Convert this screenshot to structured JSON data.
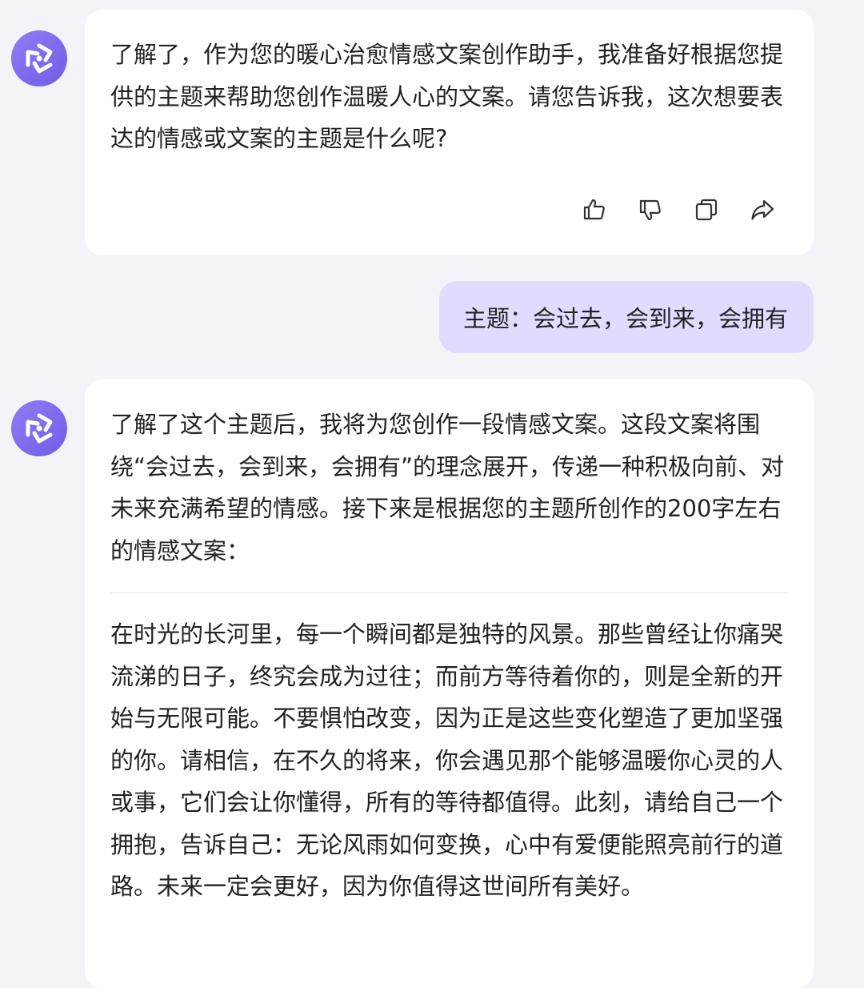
{
  "messages": [
    {
      "role": "assistant",
      "avatar_icon": "assistant-logo-icon",
      "paragraphs": [
        "了解了，作为您的暖心治愈情感文案创作助手，我准备好根据您提供的主题来帮助您创作温暖人心的文案。请您告诉我，这次想要表达的情感或文案的主题是什么呢?"
      ],
      "actions": [
        {
          "name": "like-button",
          "icon": "thumbs-up-icon"
        },
        {
          "name": "dislike-button",
          "icon": "thumbs-down-icon"
        },
        {
          "name": "copy-button",
          "icon": "copy-icon"
        },
        {
          "name": "share-button",
          "icon": "share-icon"
        }
      ]
    },
    {
      "role": "user",
      "text": "主题：会过去，会到来，会拥有"
    },
    {
      "role": "assistant",
      "avatar_icon": "assistant-logo-icon",
      "intro": "了解了这个主题后，我将为您创作一段情感文案。这段文案将围绕“会过去，会到来，会拥有”的理念展开，传递一种积极向前、对未来充满希望的情感。接下来是根据您的主题所创作的200字左右的情感文案：",
      "body": "在时光的长河里，每一个瞬间都是独特的风景。那些曾经让你痛哭流涕的日子，终究会成为过往；而前方等待着你的，则是全新的开始与无限可能。不要惧怕改变，因为正是这些变化塑造了更加坚强的你。请相信，在不久的将来，你会遇见那个能够温暖你心灵的人或事，它们会让你懂得，所有的等待都值得。此刻，请给自己一个拥抱，告诉自己：无论风雨如何变换，心中有爱便能照亮前行的道路。未来一定会更好，因为你值得这世间所有美好。"
    }
  ],
  "colors": {
    "page_bg": "#f4f4f8",
    "assistant_bubble": "#ffffff",
    "user_bubble": "#e0dcff",
    "avatar": "#7b68ee",
    "icon_stroke": "#333333"
  }
}
